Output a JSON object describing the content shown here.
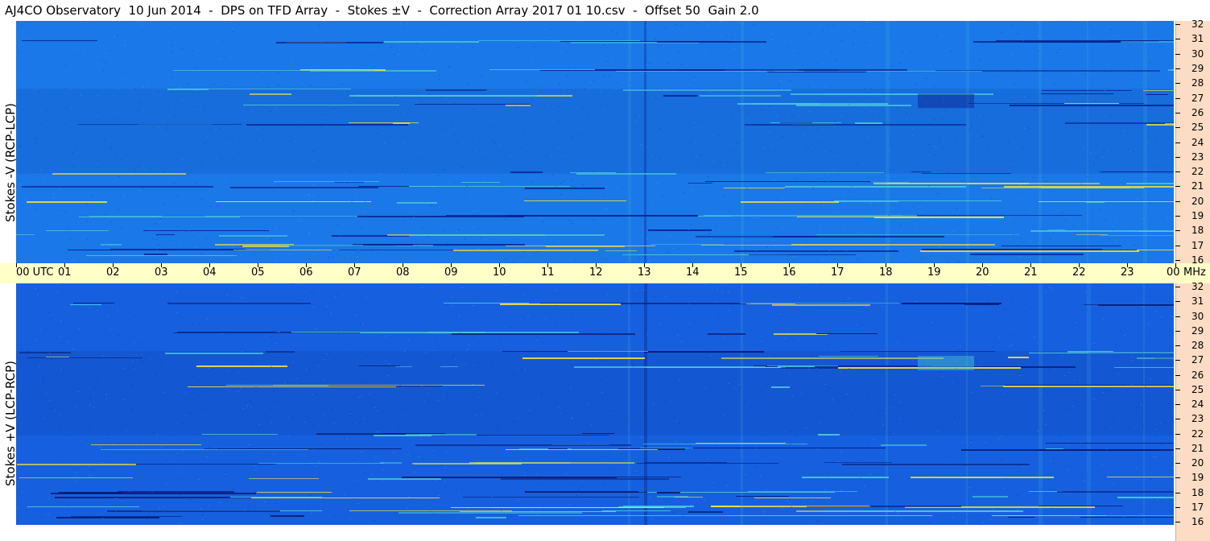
{
  "title": "AJ4CO Observatory  10 Jun 2014  -  DPS on TFD Array  -  Stokes ±V  -  Correction Array 2017 01 10.csv  -  Offset 50  Gain 2.0",
  "chart_data": [
    {
      "type": "heatmap",
      "ylabel": "Stokes -V (RCP-LCP)",
      "x_ticks": [
        "00 UTC",
        "01",
        "02",
        "03",
        "04",
        "05",
        "06",
        "07",
        "08",
        "09",
        "10",
        "11",
        "12",
        "13",
        "14",
        "15",
        "16",
        "17",
        "18",
        "19",
        "20",
        "21",
        "22",
        "23",
        "00"
      ],
      "x_unit": "MHz",
      "y_ticks": [
        "16",
        "17",
        "18",
        "19",
        "20",
        "21",
        "22",
        "23",
        "24",
        "25",
        "26",
        "27",
        "28",
        "29",
        "30",
        "31",
        "32"
      ],
      "ylim": [
        16,
        32
      ],
      "xlim": [
        0,
        24
      ],
      "colors": {
        "background": "#1a78e8",
        "low": "#0a1e8c",
        "high": "#f0e040",
        "mid": "#48c8d8"
      }
    },
    {
      "type": "heatmap",
      "ylabel": "Stokes +V (LCP-RCP)",
      "y_ticks": [
        "16",
        "17",
        "18",
        "19",
        "20",
        "21",
        "22",
        "23",
        "24",
        "25",
        "26",
        "27",
        "28",
        "29",
        "30",
        "31",
        "32"
      ],
      "ylim": [
        16,
        32
      ],
      "xlim": [
        0,
        24
      ],
      "colors": {
        "background": "#1660e0",
        "low": "#081a70",
        "high": "#f0e040",
        "mid": "#48c8d8"
      }
    }
  ]
}
